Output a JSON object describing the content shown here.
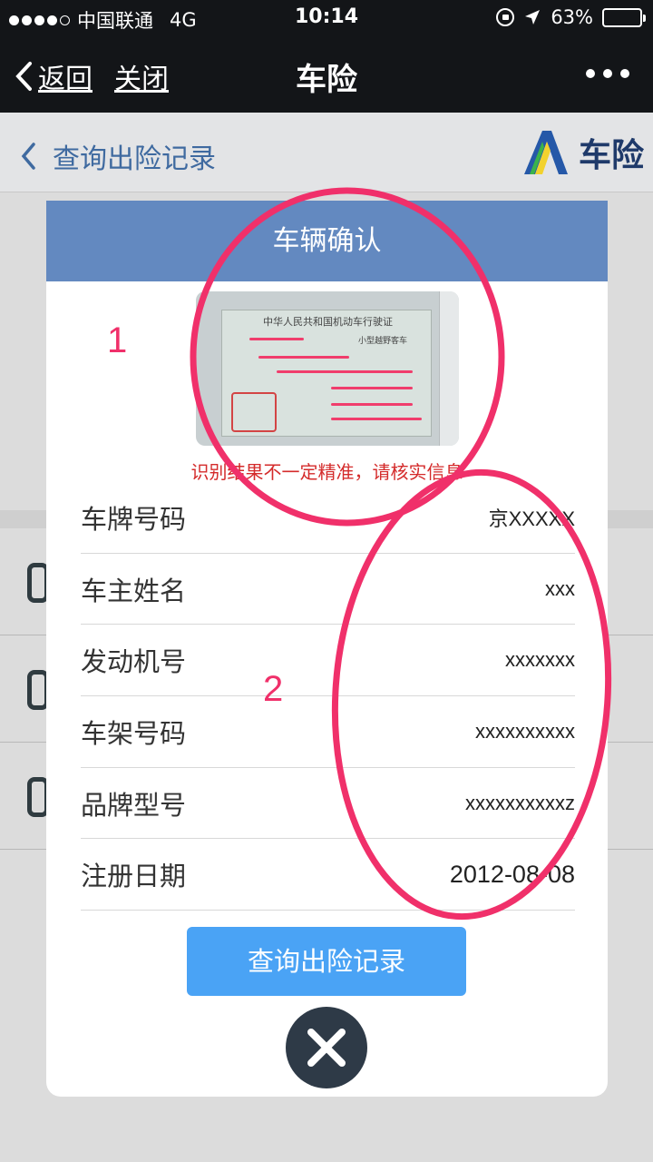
{
  "status_bar": {
    "carrier": "中国联通",
    "network": "4G",
    "time": "10:14",
    "battery_percent": "63%",
    "battery_level": 0.63
  },
  "nav": {
    "back_label": "返回",
    "close_label": "关闭",
    "title": "车险"
  },
  "page": {
    "back_label": "查询出险记录",
    "logo_text": "车险"
  },
  "modal": {
    "title": "车辆确认",
    "warning": "识别结果不一定精准，请核实信息",
    "fields": [
      {
        "label": "车牌号码",
        "value": "京XXXXX"
      },
      {
        "label": "车主姓名",
        "value": "xxx"
      },
      {
        "label": "发动机号",
        "value": "xxxxxxx"
      },
      {
        "label": "车架号码",
        "value": "xxxxxxxxxx"
      },
      {
        "label": "品牌型号",
        "value": "xxxxxxxxxxz"
      },
      {
        "label": "注册日期",
        "value": "2012-08-08"
      }
    ],
    "query_button": "查询出险记录"
  },
  "license_photo": {
    "header_text": "中华人民共和国机动车行驶证",
    "vehicle_type": "小型越野客车"
  },
  "annotations": {
    "label_1": "1",
    "label_2": "2",
    "color": "#f0306a"
  },
  "colors": {
    "nav_bg": "#131518",
    "modal_header": "#6389c0",
    "button": "#4aa3f5",
    "warning": "#d42b2b"
  }
}
